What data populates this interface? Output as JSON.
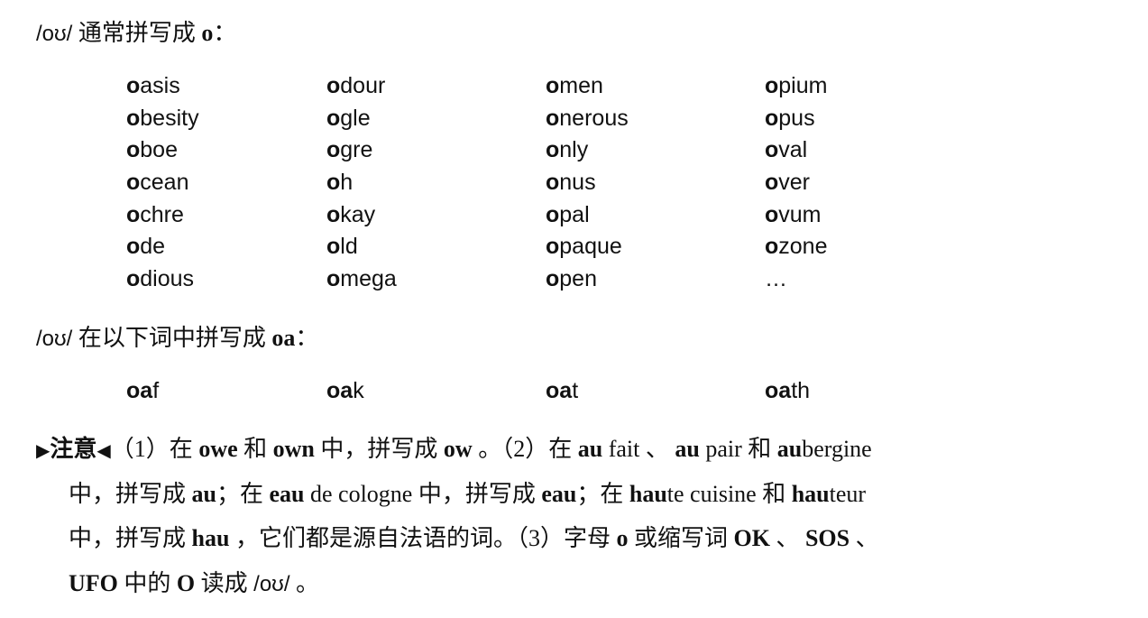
{
  "section1": {
    "heading": [
      {
        "t": "/oʊ/",
        "ipa": true
      },
      {
        "t": " 通常拼写成 "
      },
      {
        "t": "o",
        "b": true
      },
      {
        "t": "："
      }
    ],
    "words": [
      [
        [
          "o",
          "asis"
        ],
        [
          "o",
          "dour"
        ],
        [
          "o",
          "men"
        ],
        [
          "o",
          "pium"
        ]
      ],
      [
        [
          "o",
          "besity"
        ],
        [
          "o",
          "gle"
        ],
        [
          "o",
          "nerous"
        ],
        [
          "o",
          "pus"
        ]
      ],
      [
        [
          "o",
          "boe"
        ],
        [
          "o",
          "gre"
        ],
        [
          "o",
          "nly"
        ],
        [
          "o",
          "val"
        ]
      ],
      [
        [
          "o",
          "cean"
        ],
        [
          "o",
          "h"
        ],
        [
          "o",
          "nus"
        ],
        [
          "o",
          "ver"
        ]
      ],
      [
        [
          "o",
          "chre"
        ],
        [
          "o",
          "kay"
        ],
        [
          "o",
          "pal"
        ],
        [
          "o",
          "vum"
        ]
      ],
      [
        [
          "o",
          "de"
        ],
        [
          "o",
          "ld"
        ],
        [
          "o",
          "paque"
        ],
        [
          "o",
          "zone"
        ]
      ],
      [
        [
          "o",
          "dious"
        ],
        [
          "o",
          "mega"
        ],
        [
          "o",
          "pen"
        ],
        [
          "",
          "…"
        ]
      ]
    ]
  },
  "section2": {
    "heading": [
      {
        "t": "/oʊ/",
        "ipa": true
      },
      {
        "t": " 在以下词中拼写成 "
      },
      {
        "t": "oa",
        "b": true
      },
      {
        "t": "："
      }
    ],
    "words": [
      [
        [
          "oa",
          "f"
        ],
        [
          "oa",
          "k"
        ],
        [
          "oa",
          "t"
        ],
        [
          "oa",
          "th"
        ]
      ]
    ]
  },
  "note": {
    "lines": [
      [
        {
          "t": "▶",
          "tri": true
        },
        {
          "t": "注意",
          "b": true
        },
        {
          "t": "◀",
          "tri": true
        },
        {
          "t": "（1）在 "
        },
        {
          "t": "owe",
          "b": true
        },
        {
          "t": " 和 "
        },
        {
          "t": "own",
          "b": true
        },
        {
          "t": " 中，拼写成 "
        },
        {
          "t": "ow",
          "b": true
        },
        {
          "t": " 。（2）在 "
        },
        {
          "t": "au",
          "b": true
        },
        {
          "t": " fait 、 "
        },
        {
          "t": "au",
          "b": true
        },
        {
          "t": " pair 和 "
        },
        {
          "t": "au",
          "b": true
        },
        {
          "t": "bergine"
        }
      ],
      [
        {
          "t": "中，拼写成 "
        },
        {
          "t": "au",
          "b": true
        },
        {
          "t": "；在 "
        },
        {
          "t": "eau",
          "b": true
        },
        {
          "t": " de cologne 中，拼写成 "
        },
        {
          "t": "eau",
          "b": true
        },
        {
          "t": "；在 "
        },
        {
          "t": "hau",
          "b": true
        },
        {
          "t": "te cuisine 和 "
        },
        {
          "t": "hau",
          "b": true
        },
        {
          "t": "teur"
        }
      ],
      [
        {
          "t": "中，拼写成 "
        },
        {
          "t": "hau",
          "b": true
        },
        {
          "t": " ，它们都是源自法语的词。（3）字母 "
        },
        {
          "t": "o",
          "b": true
        },
        {
          "t": " 或缩写词 "
        },
        {
          "t": "OK",
          "b": true
        },
        {
          "t": " 、 "
        },
        {
          "t": "SOS",
          "b": true
        },
        {
          "t": " 、"
        }
      ],
      [
        {
          "t": "UFO",
          "b": true
        },
        {
          "t": " 中的 "
        },
        {
          "t": "O",
          "b": true
        },
        {
          "t": " 读成 "
        },
        {
          "t": "/oʊ/",
          "ipa": true
        },
        {
          "t": " 。"
        }
      ]
    ]
  }
}
